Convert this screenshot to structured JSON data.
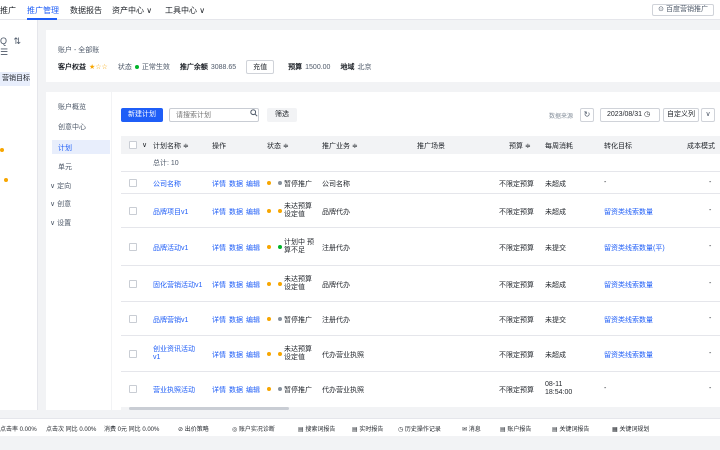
{
  "topnav": {
    "items": [
      "推广",
      "推广管理",
      "数据报告",
      "资产中心",
      "工具中心"
    ],
    "asset_arrow": "∨",
    "tool_arrow": "∨",
    "brand_label": "百度营销推广"
  },
  "leftside": {
    "tools": "Q ⇅ ☰",
    "selected_label": "营销目标"
  },
  "account": {
    "breadcrumb": "账户 - 全部账",
    "rating_label": "客户权益",
    "rating_stars": "★☆☆",
    "status_label": "状态",
    "status_value": "正常生效",
    "balance_label": "推广余额",
    "balance_value": "3088.65",
    "recharge_button": "充值",
    "budget_label": "预算",
    "budget_value": "1500.00",
    "region_label": "地域",
    "region_value": "北京"
  },
  "subnav": {
    "items": [
      "账户概览",
      "创意中心",
      "计划",
      "单元",
      "∨ 定向",
      "∨ 创意",
      "∨ 设置"
    ]
  },
  "toolbar": {
    "new_plan": "新建计划",
    "search_placeholder": "请搜索计划",
    "filter": "筛选",
    "data_source": "数据来源",
    "refresh_icon": "↻",
    "date": "2023/08/31",
    "calendar_icon": "◷",
    "custom_column": "自定义列",
    "dropdown_icon": "∨"
  },
  "table": {
    "headers": [
      "计划名称",
      "操作",
      "状态",
      "推广业务",
      "推广场景",
      "预算",
      "每周消耗",
      "转化目标",
      "成本模式"
    ],
    "total_label": "总计: 10",
    "sort_glyph": "≑",
    "rows": [
      {
        "name": "公司名称",
        "ops": [
          "详情",
          "数据",
          "编辑"
        ],
        "status": "暂停推广",
        "business": "公司名称",
        "budget": "不限定预算",
        "weekly": "未超成",
        "convert": "-",
        "cost": "-"
      },
      {
        "name": "品牌项目v1",
        "ops": [
          "详情",
          "数据",
          "编辑"
        ],
        "status": "未达预算设定值",
        "business": "品牌代办",
        "budget": "不限定预算",
        "weekly": "未超成",
        "convert": "留资类线索数量",
        "cost": "-"
      },
      {
        "name": "品牌活动v1",
        "ops": [
          "详情",
          "数据",
          "编辑"
        ],
        "status": "计划中 预算不足",
        "business": "注册代办",
        "budget": "不限定预算",
        "weekly": "未提交",
        "convert": "留资类线索数量(平)",
        "cost": "-"
      },
      {
        "name": "固化营销活动v1",
        "ops": [
          "详情",
          "数据",
          "编辑"
        ],
        "status": "未达预算设定值",
        "business": "品牌代办",
        "budget": "不限定预算",
        "weekly": "未超成",
        "convert": "留资类线索数量",
        "cost": "-"
      },
      {
        "name": "品牌营销v1",
        "ops": [
          "详情",
          "数据",
          "编辑"
        ],
        "status": "暂停推广",
        "business": "注册代办",
        "budget": "不限定预算",
        "weekly": "未提交",
        "convert": "留资类线索数量",
        "cost": "-"
      },
      {
        "name": "创业资讯活动v1",
        "ops": [
          "详情",
          "数据",
          "编辑"
        ],
        "status": "未达预算设定值",
        "business": "代办营业执照",
        "budget": "不限定预算",
        "weekly": "未超成",
        "convert": "留资类线索数量",
        "cost": "-"
      },
      {
        "name": "营业执照活动",
        "ops": [
          "详情",
          "数据",
          "编辑"
        ],
        "status": "暂停推广",
        "business": "代办营业执照",
        "budget": "不限定预算",
        "weekly": "08-11 18:54:00",
        "convert": "-",
        "cost": "-"
      }
    ]
  },
  "bottombar": {
    "items": [
      "点击率 0.00%",
      "点击次 同比 0.00%",
      "消费 0元 同比 0.00%",
      "出价策略",
      "账户实况诊断",
      "搜索词报告",
      "实时报告",
      "历史操作记录",
      "消息",
      "账户报告",
      "关键词报告",
      "关键词规划"
    ]
  },
  "colors": {
    "accent": "#1f5ef7",
    "warning": "#f7a600",
    "success": "#00b42a"
  }
}
